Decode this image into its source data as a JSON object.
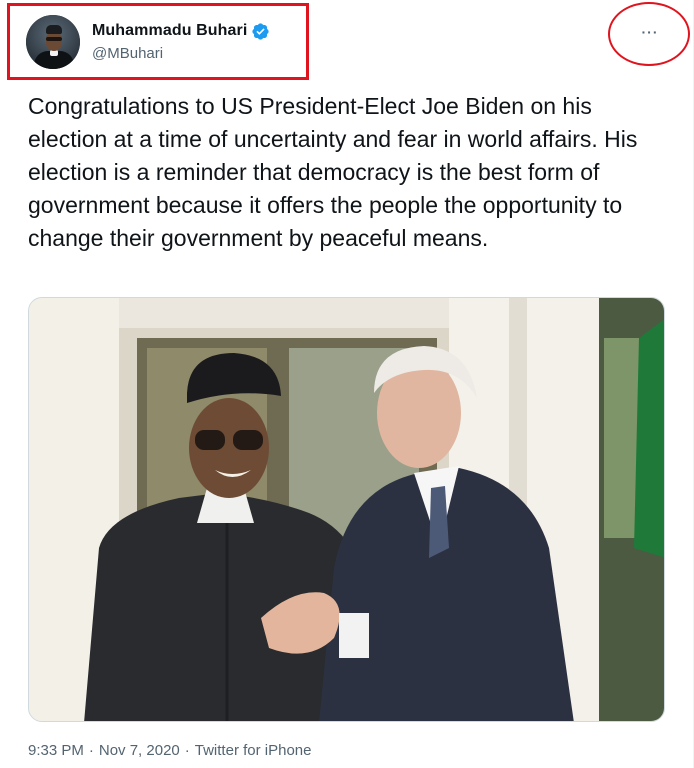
{
  "author": {
    "display_name": "Muhammadu Buhari",
    "handle": "@MBuhari",
    "avatar_icon": "user-avatar",
    "verified_icon": "verified-badge-icon",
    "verified_color": "#1d9bf0"
  },
  "more_button": {
    "label": "···",
    "icon": "more-options-icon"
  },
  "tweet": {
    "text": "Congratulations to US President-Elect Joe Biden on his election at a time of uncertainty and fear in world affairs. His election is a reminder that democracy is the best form of government because it offers the people the opportunity to change their government by peaceful means."
  },
  "meta": {
    "time": "9:33 PM",
    "separator": "·",
    "date": "Nov 7, 2020",
    "source": "Twitter for iPhone"
  },
  "annotations": {
    "highlight_color": "#e0141e"
  }
}
